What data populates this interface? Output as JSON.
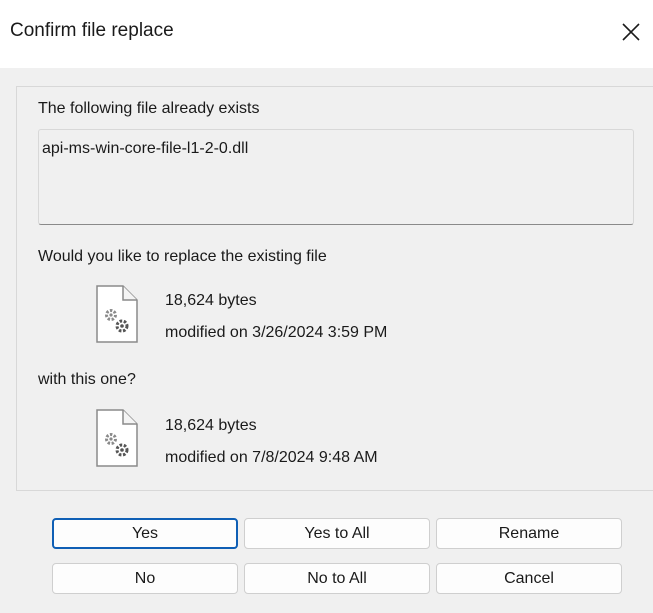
{
  "dialog": {
    "title": "Confirm file replace"
  },
  "existing": {
    "heading": "The following file already exists",
    "filename": "api-ms-win-core-file-l1-2-0.dll"
  },
  "question": {
    "replace_text": "Would you like to replace the existing file",
    "with_text": "with this one?"
  },
  "existing_file": {
    "size": "18,624 bytes",
    "modified": "modified on 3/26/2024 3:59 PM",
    "icon": "settings-file-icon"
  },
  "new_file": {
    "size": "18,624 bytes",
    "modified": "modified on 7/8/2024 9:48 AM",
    "icon": "settings-file-icon"
  },
  "buttons": {
    "yes": "Yes",
    "yes_to_all": "Yes to All",
    "rename": "Rename",
    "no": "No",
    "no_to_all": "No to All",
    "cancel": "Cancel"
  },
  "colors": {
    "default_button_border": "#0f5fb5",
    "dialog_background": "#f0f0f0"
  }
}
